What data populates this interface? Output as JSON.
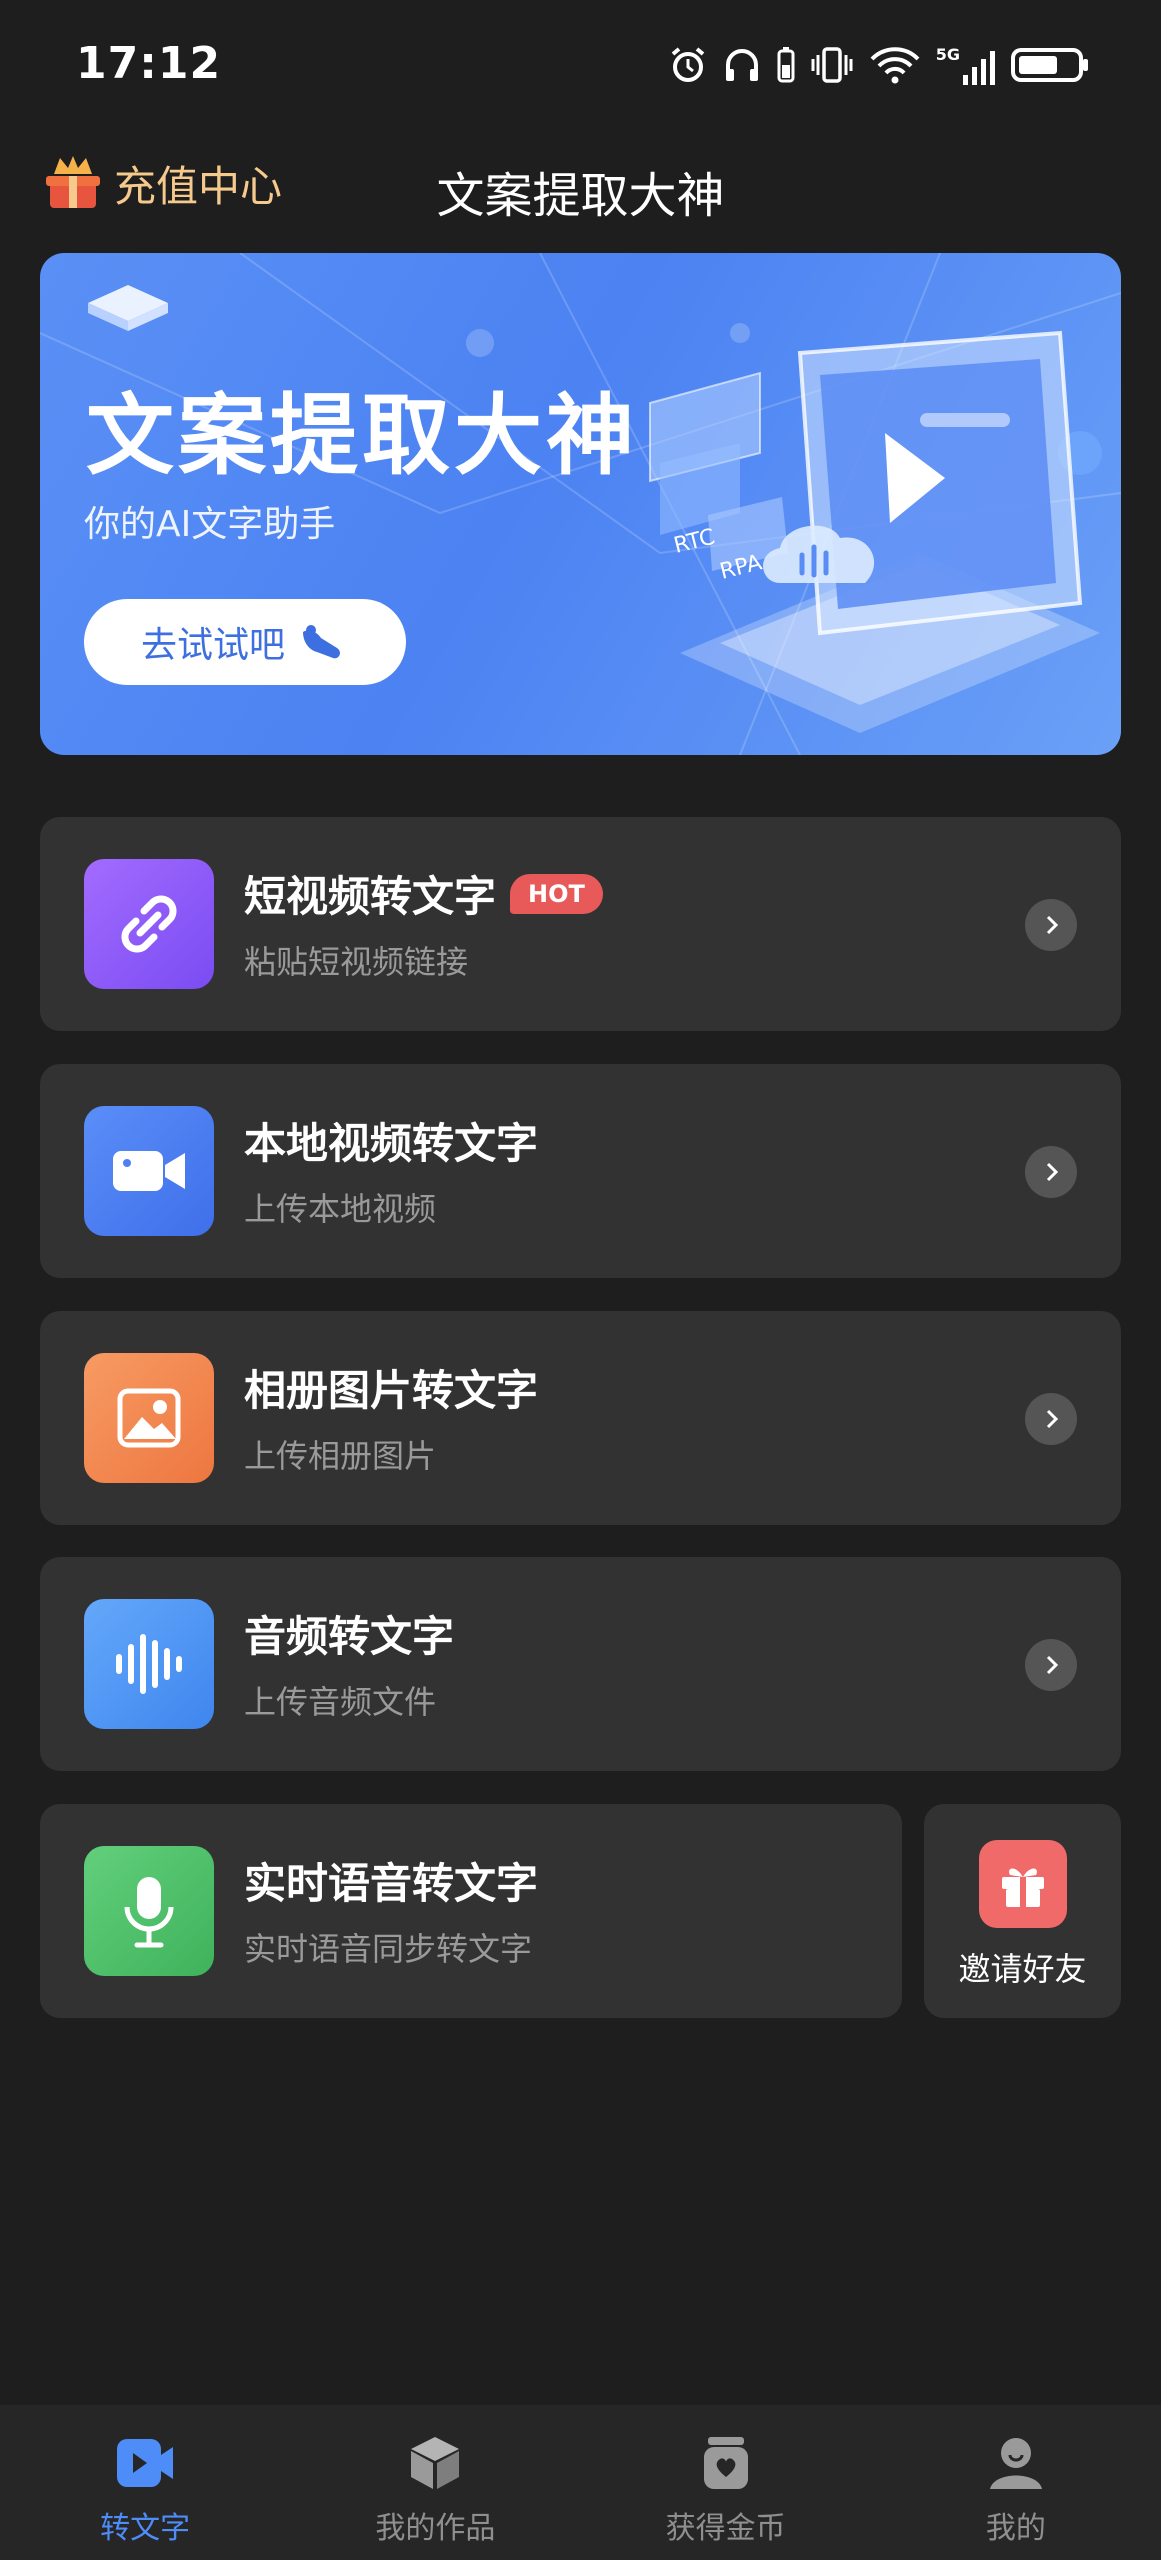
{
  "status_bar": {
    "time": "17:12",
    "network": "5G"
  },
  "header": {
    "recharge_label": "充值中心",
    "title": "文案提取大神"
  },
  "banner": {
    "title": "文案提取大神",
    "subtitle": "你的AI文字助手",
    "button_label": "去试试吧",
    "tag_rtc": "RTC",
    "tag_rpa": "RPA"
  },
  "features": [
    {
      "title": "短视频转文字",
      "badge": "HOT",
      "subtitle": "粘贴短视频链接",
      "icon": "link-icon",
      "color": "#8b5cf6"
    },
    {
      "title": "本地视频转文字",
      "subtitle": "上传本地视频",
      "icon": "video-camera-icon",
      "color": "#4f7ff5"
    },
    {
      "title": "相册图片转文字",
      "subtitle": "上传相册图片",
      "icon": "image-icon",
      "color": "#f2854f"
    },
    {
      "title": "音频转文字",
      "subtitle": "上传音频文件",
      "icon": "audio-wave-icon",
      "color": "#4f9af5"
    },
    {
      "title": "实时语音转文字",
      "subtitle": "实时语音同步转文字",
      "icon": "microphone-icon",
      "color": "#4fc06a"
    }
  ],
  "invite": {
    "label": "邀请好友",
    "icon": "gift-icon",
    "color": "#f06a6a"
  },
  "tabs": [
    {
      "label": "转文字",
      "icon": "video-play-icon",
      "active": true
    },
    {
      "label": "我的作品",
      "icon": "box-icon",
      "active": false
    },
    {
      "label": "获得金币",
      "icon": "coin-jar-icon",
      "active": false
    },
    {
      "label": "我的",
      "icon": "user-icon",
      "active": false
    }
  ],
  "colors": {
    "accent": "#4e8cf7",
    "recharge": "#f6c98d",
    "card_bg": "#323232",
    "page_bg": "#1e1e1e"
  }
}
